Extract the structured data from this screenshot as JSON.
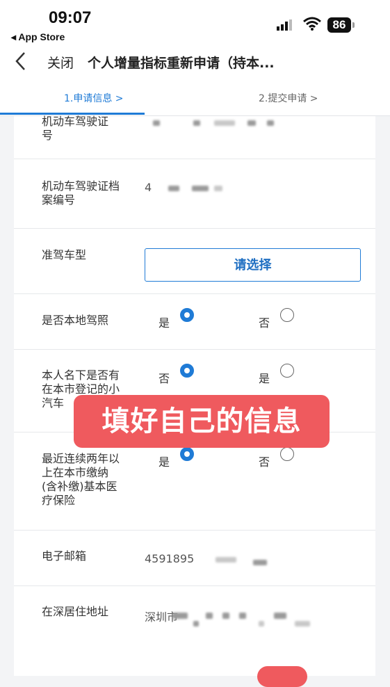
{
  "status": {
    "time": "09:07",
    "back_app": "◂ App Store",
    "battery": "86"
  },
  "nav": {
    "close": "关闭",
    "title": "个人增量指标重新申请（持本..."
  },
  "tabs": [
    {
      "label": "1.申请信息 >"
    },
    {
      "label": "2.提交申请 >"
    }
  ],
  "form": {
    "license_no_label": "机动车驾驶证\n号",
    "license_file_label": "机动车驾驶证档\n案编号",
    "license_file_value": "4",
    "vehicle_type_label": "准驾车型",
    "vehicle_type_button": "请选择",
    "local_license_label": "是否本地驾照",
    "local_license_opt_yes": "是",
    "local_license_opt_no": "否",
    "has_car_label": "本人名下是否有\n在本市登记的小\n汽车",
    "has_car_opt_no": "否",
    "has_car_opt_yes": "是",
    "insurance_label": "最近连续两年以\n上在本市缴纳\n(含补缴)基本医\n疗保险",
    "insurance_opt_yes": "是",
    "insurance_opt_no": "否",
    "email_label": "电子邮箱",
    "email_value": "4591895",
    "address_label": "在深居住地址",
    "address_value": "深圳市"
  },
  "selections": {
    "local_license": "是",
    "has_car": "否",
    "insurance": "是"
  },
  "overlay_text": "填好自己的信息",
  "colors": {
    "accent": "#1f7bd6",
    "overlay": "#ef5a5e"
  }
}
